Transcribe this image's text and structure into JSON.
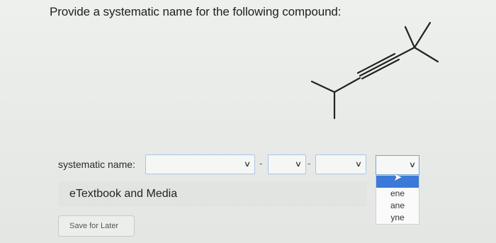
{
  "question": {
    "text": "Provide a systematic name for the following compound:"
  },
  "molecule": {
    "icon": "skeletal-structure-alkyne"
  },
  "answer": {
    "label": "systematic name:",
    "separators": [
      "-",
      "-"
    ],
    "dropdown_options": [
      "ene",
      "ane",
      "yne"
    ]
  },
  "etextbook": {
    "label": "eTextbook and Media"
  },
  "save": {
    "label": "Save for Later"
  }
}
